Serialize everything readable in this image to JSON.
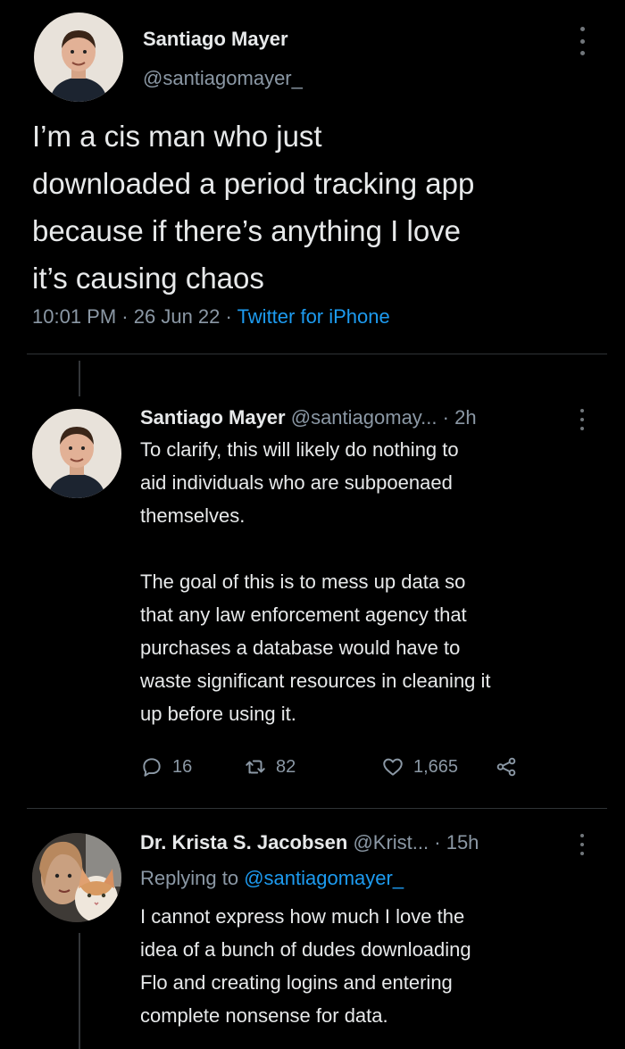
{
  "main_tweet": {
    "author_name": "Santiago Mayer",
    "author_handle": "@santiagomayer_",
    "text_lines": [
      "I’m a cis man who just",
      "downloaded a period tracking app",
      "because if there’s anything I love",
      "it’s causing chaos"
    ],
    "time": "10:01 PM",
    "date": "26 Jun 22",
    "source": "Twitter for iPhone",
    "separator": "·"
  },
  "reply_1": {
    "author_name": "Santiago Mayer",
    "author_handle": "@santiagomay...",
    "time_ago": "2h",
    "separator": "·",
    "body_lines": [
      "To clarify, this will likely do nothing to",
      "aid individuals who are subpoenaed",
      "themselves.",
      "",
      "The goal of this is to mess up data so",
      "that any law enforcement agency that",
      "purchases a database would have to",
      "waste significant resources in cleaning it",
      "up before using it."
    ],
    "actions": {
      "replies": "16",
      "retweets": "82",
      "likes": "1,665"
    }
  },
  "reply_2": {
    "author_name": "Dr. Krista S. Jacobsen",
    "author_handle": "@Krist...",
    "time_ago": "15h",
    "separator": "·",
    "replying_prefix": "Replying to",
    "replying_to": "@santiagomayer_",
    "body_lines": [
      "I cannot express how much I love the",
      "idea of a bunch of dudes downloading",
      "Flo and creating logins and entering",
      "complete nonsense for data."
    ]
  },
  "icons": {
    "more": "more-vertical-icon",
    "reply": "reply-icon",
    "retweet": "retweet-icon",
    "like": "heart-icon",
    "share": "share-icon"
  },
  "colors": {
    "background": "#000000",
    "text": "#e7e9ea",
    "secondary": "#8b98a5",
    "link": "#1d9bf0"
  }
}
